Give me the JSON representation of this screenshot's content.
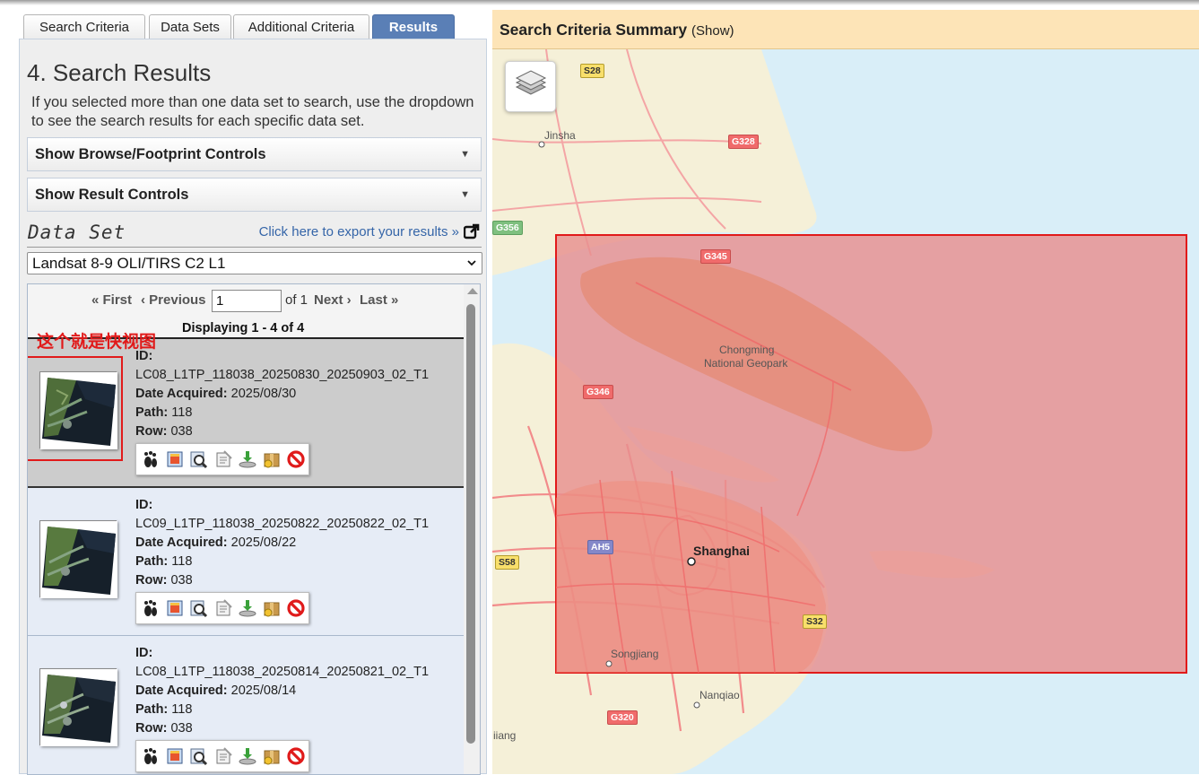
{
  "tabs": [
    {
      "label": "Search Criteria",
      "active": false
    },
    {
      "label": "Data Sets",
      "active": false
    },
    {
      "label": "Additional Criteria",
      "active": false
    },
    {
      "label": "Results",
      "active": true
    }
  ],
  "results_panel": {
    "title": "4. Search Results",
    "intro": "If you selected more than one data set to search, use the dropdown to see the search results for each specific data set.",
    "browse_controls": "Show Browse/Footprint Controls",
    "result_controls": "Show Result Controls",
    "dataset_label": "Data Set",
    "export_link": "Click here to export your results »",
    "dataset_selected": "Landsat 8-9 OLI/TIRS C2 L1",
    "pager": {
      "first": "« First",
      "previous": "‹ Previous",
      "page_value": "1",
      "of_label": "of 1",
      "next": "Next ›",
      "last": "Last »"
    },
    "displaying": "Displaying 1 - 4 of 4",
    "annotation": "这个就是快视图",
    "field_labels": {
      "id": "ID:",
      "date": "Date Acquired:",
      "path": "Path:",
      "row": "Row:"
    },
    "results": [
      {
        "id": "LC08_L1TP_118038_20250830_20250903_02_T1",
        "date": "2025/08/30",
        "path": "118",
        "row": "038"
      },
      {
        "id": "LC09_L1TP_118038_20250822_20250822_02_T1",
        "date": "2025/08/22",
        "path": "118",
        "row": "038"
      },
      {
        "id": "LC08_L1TP_118038_20250814_20250821_02_T1",
        "date": "2025/08/14",
        "path": "118",
        "row": "038"
      }
    ],
    "action_icons": [
      "footprint-icon",
      "overlay-icon",
      "compare-icon",
      "metadata-icon",
      "download-icon",
      "order-icon",
      "exclude-icon"
    ]
  },
  "map": {
    "header_title": "Search Criteria Summary",
    "header_toggle": "(Show)",
    "labels": {
      "jinsha": "Jinsha",
      "chongming1": "Chongming",
      "chongming2": "National Geopark",
      "shanghai": "Shanghai",
      "songjiang": "Songjiang",
      "nanqiao": "Nanqiao",
      "jiang": "iiang"
    },
    "shields": {
      "s28": "S28",
      "g328": "G328",
      "g356": "G356",
      "g345": "G345",
      "g346": "G346",
      "ah5": "AH5",
      "s58": "S58",
      "s32": "S32",
      "g320": "G320"
    },
    "colors": {
      "land": "#f5f0d8",
      "water": "#d9eef8",
      "footprint_fill": "#e88f8f",
      "footprint_stroke": "#e11a1a"
    }
  }
}
